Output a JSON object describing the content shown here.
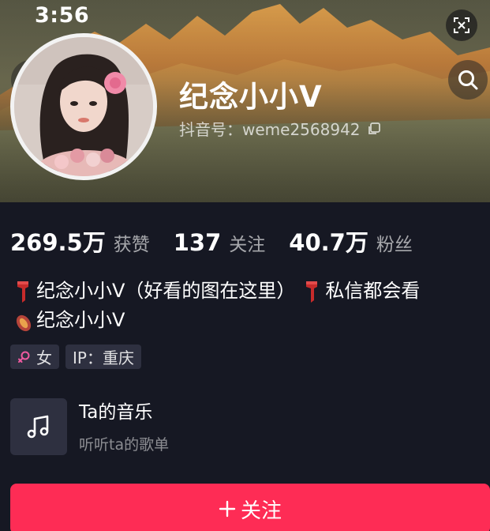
{
  "status_bar": {
    "time": "3:56"
  },
  "profile": {
    "nickname": "纪念小小Ⅴ",
    "douyin_id": "抖音号：weme2568942"
  },
  "stats": [
    {
      "value": "269.5万",
      "label": "获赞"
    },
    {
      "value": "137",
      "label": "关注"
    },
    {
      "value": "40.7万",
      "label": "粉丝"
    }
  ],
  "bio": {
    "line1": "纪念小小Ⅴ（好看的图在这里）",
    "line1_tail": "私信都会看",
    "line2": "纪念小小Ⅴ"
  },
  "tags": {
    "gender": "女",
    "ip": "IP：重庆"
  },
  "music": {
    "title": "Ta的音乐",
    "subtitle": "听听ta的歌单"
  },
  "actions": {
    "follow_label": "关注"
  },
  "icons": {
    "back": "chevron-left-icon",
    "search": "search-icon",
    "expand": "expand-icon",
    "copy": "copy-icon",
    "music": "music-note-icon",
    "female": "female-symbol-icon",
    "plus": "plus-icon"
  },
  "colors": {
    "background": "#161823",
    "accent": "#fe2c55",
    "chip": "#2e3040",
    "female": "#f05aa0"
  }
}
